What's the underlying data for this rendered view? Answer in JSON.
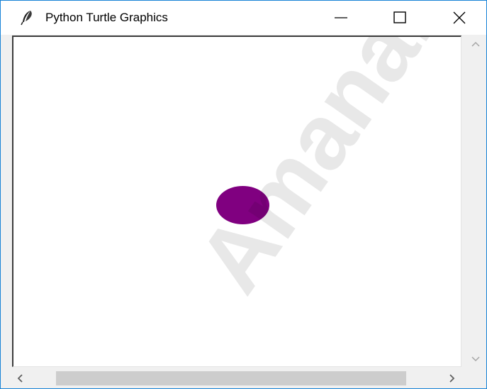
{
  "window": {
    "title": "Python Turtle Graphics",
    "app_icon": "feather-icon",
    "controls": {
      "minimize_icon": "minimize-icon",
      "maximize_icon": "maximize-icon",
      "close_icon": "close-icon"
    }
  },
  "canvas": {
    "background_color": "#ffffff",
    "dot_color": "#800080",
    "watermark_text": "Amanah"
  },
  "scrollbars": {
    "vertical": {
      "up_icon": "chevron-up-icon",
      "down_icon": "chevron-down-icon"
    },
    "horizontal": {
      "left_icon": "chevron-left-icon",
      "right_icon": "chevron-right-icon"
    }
  },
  "colors": {
    "window_border": "#1883d7",
    "scrollbar_track": "#f0f0f0",
    "scrollbar_thumb": "#cdcdcd"
  }
}
